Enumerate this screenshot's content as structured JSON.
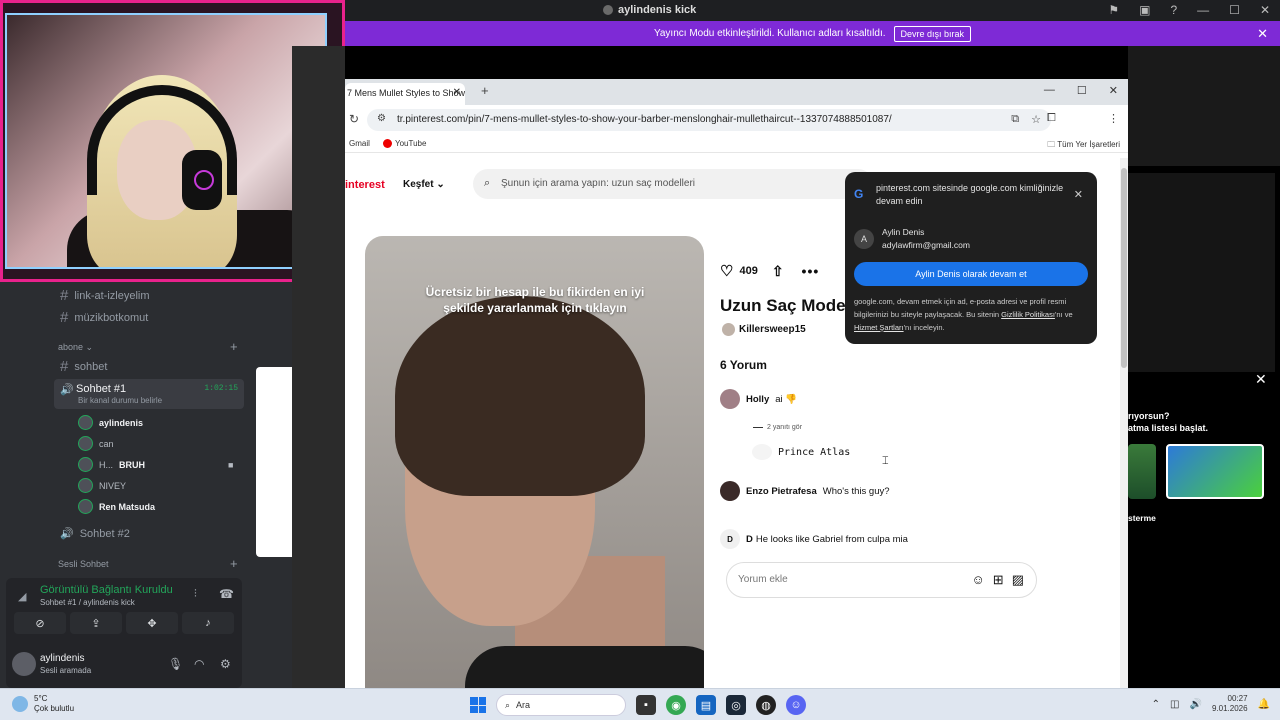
{
  "window": {
    "title": "aylindenis kick"
  },
  "banner": {
    "text": "Yayıncı Modu etkinleştirildi. Kullanıcı adları kısaltıldı.",
    "button": "Devre dışı bırak"
  },
  "discord": {
    "channels": [
      {
        "name": "link-at-izleyelim"
      },
      {
        "name": "müzikbotkomut"
      }
    ],
    "category1": "abone",
    "sohbet": "sohbet",
    "voice_channel": {
      "name": "Sohbet #1",
      "status": "Bir kanal durumu belirle",
      "time": "1:02:15"
    },
    "voice_users": [
      {
        "name": "aylindenis",
        "bold": true
      },
      {
        "name": "can",
        "bold": false
      },
      {
        "name": "H...",
        "extra": "BRUH",
        "bold": false
      },
      {
        "name": "NIVEY",
        "bold": false
      },
      {
        "name": "Ren Matsuda",
        "bold": true
      }
    ],
    "voice_channel2": "Sohbet #2",
    "category2": "Sesli Sohbet",
    "connection": {
      "title": "Görüntülü Bağlantı Kuruldu",
      "sub": "Sohbet #1 / aylindenis kick"
    },
    "user": {
      "name": "aylindenis",
      "status": "Sesli aramada"
    }
  },
  "browser": {
    "tab_title": "7 Mens Mullet Styles to Show Y...",
    "url": "tr.pinterest.com/pin/7-mens-mullet-styles-to-show-your-barber-menslonghair-mullethaircut--1337074888501087/",
    "bookmarks": [
      "Gmail",
      "YouTube"
    ],
    "all_bookmarks": "Tüm Yer İşaretleri"
  },
  "pinterest": {
    "logo": "interest",
    "explore": "Keşfet",
    "search_placeholder": "Şunun için arama yapın: uzun saç modelleri",
    "image_cta": "Ücretsiz bir hesap ile bu fikirden en iyi şekilde yararlanmak için tıklayın",
    "likes": "409",
    "title": "Uzun Saç Mode",
    "author": "Killersweep15",
    "comments_count": "6 Yorum",
    "comments": [
      {
        "user": "Holly",
        "text": "ai 👎"
      },
      {
        "user": "Enzo Pietrafesa",
        "text": "Who's this guy?"
      },
      {
        "user": "D",
        "text": "He looks like Gabriel from culpa mia"
      }
    ],
    "replies_link": "2 yanıtı gör",
    "reply_user": "Prince Atlas",
    "comment_placeholder": "Yorum ekle"
  },
  "google_popup": {
    "header": "pinterest.com sitesinde google.com kimliğinizle devam edin",
    "account_initial": "A",
    "account_name": "Aylin Denis",
    "account_email": "adylawfirm@gmail.com",
    "continue_button": "Aylin Denis olarak devam et",
    "legal": "google.com, devam etmek için ad, e-posta adresi ve profil resmi bilgilerinizi bu siteyle paylaşacak. Bu sitenin",
    "privacy": "Gizlilik Politikası",
    "and": "'nı ve",
    "terms": "Hizmet Şartları",
    "review": "'nı inceleyin."
  },
  "right_panel": {
    "line1": "rıyorsun?",
    "line2": "atma listesi başlat.",
    "line3": "sterme"
  },
  "taskbar": {
    "weather_temp": "5°C",
    "weather_desc": "Çok bulutlu",
    "search": "Ara",
    "time": "00:27",
    "date": "9.01.2026"
  }
}
